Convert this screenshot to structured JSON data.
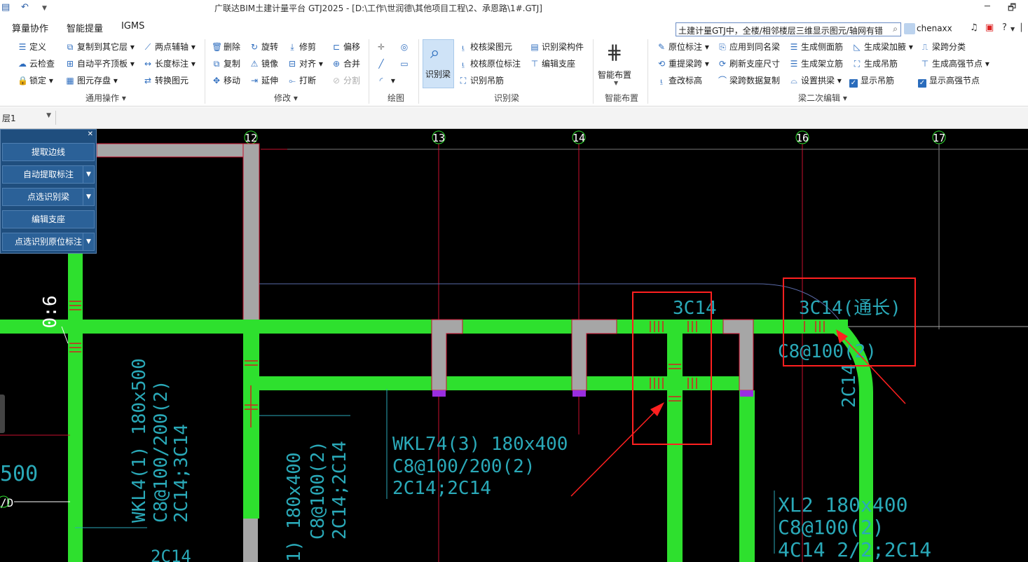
{
  "title_bar": {
    "title": "广联达BIM土建计量平台 GTJ2025 - [D:\\工作\\世润德\\其他项目工程\\2、承恩路\\1#.GTJ]",
    "restore_glyph": "🗗"
  },
  "menu": {
    "items": [
      "算量协作",
      "智能提量",
      "IGMS"
    ]
  },
  "search": {
    "value": "土建计量GTJ中，全楼/相邻楼层三维显示图元/轴网有错"
  },
  "user": {
    "name": "chenaxx"
  },
  "ribbon": {
    "general": {
      "label": "通用操作",
      "items": [
        "定义",
        "云检查",
        "锁定",
        "复制到其它层",
        "自动平齐顶板",
        "图元存盘",
        "两点辅轴",
        "长度标注",
        "转换图元"
      ]
    },
    "modify": {
      "label": "修改",
      "items": [
        "删除",
        "复制",
        "移动",
        "旋转",
        "镜像",
        "延伸",
        "修剪",
        "对齐",
        "打断",
        "偏移",
        "合并",
        "分割"
      ]
    },
    "draw": {
      "label": "绘图"
    },
    "recognize": {
      "label": "识别梁",
      "big_button": "识别梁",
      "items": [
        "校核梁图元",
        "校核原位标注",
        "识别吊筋",
        "识别梁构件",
        "编辑支座"
      ]
    },
    "smart": {
      "label": "智能布置",
      "big_button": "智能布置"
    },
    "beam_edit": {
      "label": "梁二次编辑",
      "items": [
        "原位标注",
        "重提梁跨",
        "查改标高",
        "应用到同名梁",
        "刷新支座尺寸",
        "梁跨数据复制",
        "生成侧面筋",
        "生成架立筋",
        "设置拱梁",
        "生成梁加腋",
        "生成吊筋",
        "显示吊筋",
        "梁跨分类",
        "生成高强节点",
        "显示高强节点"
      ]
    }
  },
  "floor_selector": {
    "value": "层1"
  },
  "panel": {
    "buttons": [
      "提取边线",
      "自动提取标注",
      "点选识别梁",
      "编辑支座",
      "点选识别原位标注"
    ]
  },
  "canvas": {
    "axis_labels": [
      "12",
      "13",
      "14",
      "16",
      "17"
    ],
    "annotations": {
      "dim_06": "0:6",
      "left_500": "500",
      "left_d": "/D",
      "wkl4_1": "WKL4(1) 180x500",
      "wkl4_2": "C8@100/200(2)",
      "wkl4_3": "2C14;3C14",
      "wkl4_bottom": "2C14",
      "mid_1": "1) 180x400",
      "mid_2": "C8@100(2)",
      "mid_3": "2C14;2C14",
      "wkl74_1": "WKL74(3) 180x400",
      "wkl74_2": "C8@100/200(2)",
      "wkl74_3": "2C14;2C14",
      "c3c14_a": "3C14",
      "c3c14_b": "3C14(通长)",
      "c8_100": "C8@100(2)",
      "c2c14_vert": "2C14",
      "xl2_1": "XL2 180x400",
      "xl2_2": "C8@100(2)",
      "xl2_3": "4C14 2/2;2C14"
    },
    "colors": {
      "background": "#000000",
      "beam": "#2ee02e",
      "column": "#a6a6a6",
      "text": "#2aa9b8",
      "highlight": "#ff2020",
      "axis": "#c8102e"
    }
  }
}
